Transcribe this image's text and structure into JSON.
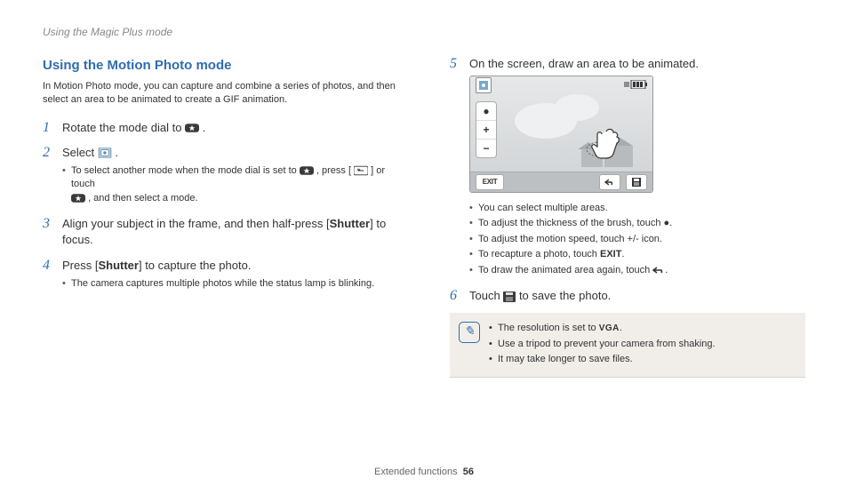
{
  "running_header": "Using the Magic Plus mode",
  "heading": "Using the Motion Photo mode",
  "intro": "In Motion Photo mode, you can capture and combine a series of photos, and then select an area to be animated to create a GIF animation.",
  "steps": {
    "s1_a": "Rotate the mode dial to ",
    "s1_b": " .",
    "s2_a": "Select ",
    "s2_b": ".",
    "s2_sub_a": "To select another mode when the mode dial is set to ",
    "s2_sub_b": " , press [",
    "s2_sub_c": "] or touch ",
    "s2_sub_d": " , and then select a mode.",
    "s3_a": "Align your subject in the frame, and then half-press [",
    "s3_bold": "Shutter",
    "s3_b": "] to focus.",
    "s4_a": "Press [",
    "s4_bold": "Shutter",
    "s4_b": "] to capture the photo.",
    "s4_sub": "The camera captures multiple photos while the status lamp is blinking.",
    "s5": "On the screen, draw an area to be animated.",
    "s5_sub1": "You can select multiple areas.",
    "s5_sub2_a": "To adjust the thickness of the brush, touch ",
    "s5_sub2_b": ".",
    "s5_sub3": "To adjust the motion speed, touch +/- icon.",
    "s5_sub4_a": "To recapture a photo, touch ",
    "s5_sub4_b": ".",
    "s5_sub5_a": "To draw the animated area again, touch ",
    "s5_sub5_b": ".",
    "s6_a": "Touch ",
    "s6_b": " to save the photo.",
    "exit_label": "EXIT"
  },
  "note": {
    "n1_a": "The resolution is set to ",
    "n1_vga": "VGA",
    "n1_b": ".",
    "n2": "Use a tripod to prevent your camera from shaking.",
    "n3": "It may take longer to save files."
  },
  "footer": {
    "section": "Extended functions",
    "page": "56"
  }
}
